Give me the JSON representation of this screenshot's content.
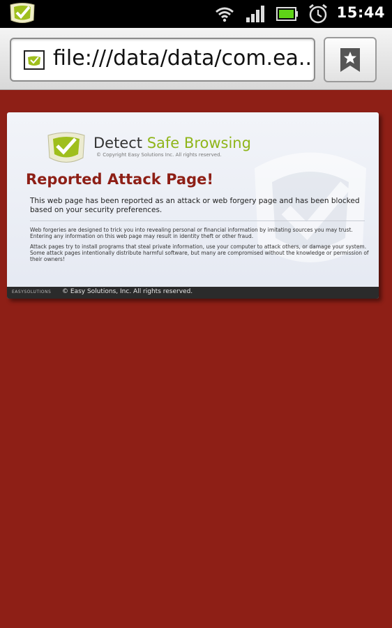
{
  "status_bar": {
    "time": "15:44",
    "icons": [
      "app-check-icon",
      "wifi-icon",
      "signal-icon",
      "battery-icon",
      "alarm-icon"
    ]
  },
  "address_bar": {
    "url": "file:///data/data/com.ea...",
    "favicon": "page-favicon-icon",
    "bookmark_icon": "bookmark-star-icon"
  },
  "page": {
    "background_color": "#8e1f16",
    "brand": {
      "name_prefix": "Detect",
      "name_accent": "Safe Browsing",
      "copyright": "© Copyright Easy Solutions Inc. All rights reserved.",
      "accent_color": "#8fb51a"
    },
    "headline": "Reported Attack Page!",
    "lead": "This web page has been reported as an attack or web forgery page and has been blocked based on your security preferences.",
    "paragraphs": [
      "Web forgeries are designed to trick you into revealing personal or financial information by imitating sources you may trust. Entering any information on this web page may result in identity theft or other fraud.",
      "Attack pages try to install programs that steal private information, use your computer to attack others, or damage your system. Some attack pages intentionally distribute harmful software, but many are compromised without the knowledge or permission of their owners!"
    ],
    "footer": {
      "brand": "EASYSOLUTIONS",
      "text": "© Easy Solutions, Inc. All rights reserved."
    }
  }
}
